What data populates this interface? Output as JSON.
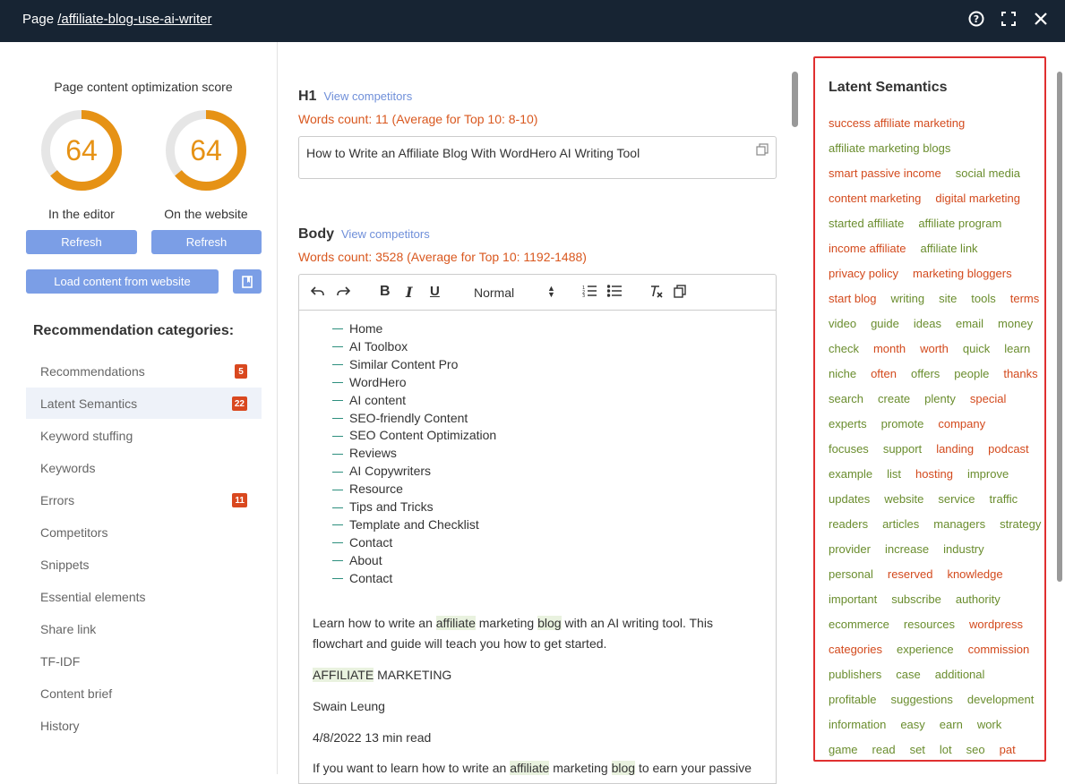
{
  "header": {
    "page_prefix": "Page ",
    "page_path": "/affiliate-blog-use-ai-writer"
  },
  "score": {
    "title": "Page content optimization score",
    "editor_value": "64",
    "editor_label": "In the editor",
    "website_value": "64",
    "website_label": "On the website",
    "refresh_label": "Refresh",
    "load_label": "Load content from website",
    "value_fraction": 0.64
  },
  "recommendations": {
    "title": "Recommendation categories:",
    "items": [
      {
        "label": "Recommendations",
        "badge": "5"
      },
      {
        "label": "Latent Semantics",
        "badge": "22"
      },
      {
        "label": "Keyword stuffing",
        "badge": ""
      },
      {
        "label": "Keywords",
        "badge": ""
      },
      {
        "label": "Errors",
        "badge": "11"
      },
      {
        "label": "Competitors",
        "badge": ""
      },
      {
        "label": "Snippets",
        "badge": ""
      },
      {
        "label": "Essential elements",
        "badge": ""
      },
      {
        "label": "Share link",
        "badge": ""
      },
      {
        "label": "TF-IDF",
        "badge": ""
      },
      {
        "label": "Content brief",
        "badge": ""
      },
      {
        "label": "History",
        "badge": ""
      }
    ]
  },
  "h1": {
    "label": "H1",
    "view_competitors": "View competitors",
    "words_count": "Words count: 11 (Average for Top 10: 8-10)",
    "text": "How to Write an Affiliate Blog With WordHero AI Writing Tool"
  },
  "body": {
    "label": "Body",
    "view_competitors": "View competitors",
    "words_count": "Words count: 3528 (Average for Top 10: 1192-1488)",
    "format_select": "Normal",
    "menu": [
      "Home",
      "AI Toolbox",
      "Similar Content Pro",
      "WordHero",
      "AI content",
      "SEO-friendly Content",
      "SEO Content Optimization",
      "Reviews",
      "AI Copywriters",
      "Resource",
      "Tips and Tricks",
      "Template and Checklist",
      "Contact",
      "About",
      "Contact"
    ],
    "p1_a": "Learn how to write an ",
    "p1_hl1": "affiliate",
    "p1_b": " marketing ",
    "p1_hl2": "blog",
    "p1_c": " with an AI writing tool. This",
    "p1_line2": "flowchart and guide will teach you how to get started.",
    "p2_hl": "AFFILIATE",
    "p2_rest": " MARKETING",
    "author": "Swain Leung",
    "date": "4/8/2022 13 min read",
    "p3_a": "If you want to learn how to write an ",
    "p3_hl1": "affiliate",
    "p3_b": " marketing ",
    "p3_hl2": "blog",
    "p3_c": " to earn your passive"
  },
  "latent": {
    "title": "Latent Semantics",
    "colors": {
      "red": "#d34a1d",
      "green": "#6a8d2e"
    },
    "rows": [
      [
        [
          "success affiliate marketing",
          "r"
        ]
      ],
      [
        [
          "affiliate marketing blogs",
          "g"
        ]
      ],
      [
        [
          "smart passive income",
          "r"
        ],
        [
          "social media",
          "g"
        ]
      ],
      [
        [
          "content marketing",
          "r"
        ],
        [
          "digital marketing",
          "r"
        ]
      ],
      [
        [
          "started affiliate",
          "g"
        ],
        [
          "affiliate program",
          "g"
        ]
      ],
      [
        [
          "income affiliate",
          "r"
        ],
        [
          "affiliate link",
          "g"
        ]
      ],
      [
        [
          "privacy policy",
          "r"
        ],
        [
          "marketing bloggers",
          "r"
        ]
      ],
      [
        [
          "start blog",
          "r"
        ],
        [
          "writing",
          "g"
        ],
        [
          "site",
          "g"
        ],
        [
          "tools",
          "g"
        ],
        [
          "terms",
          "r"
        ]
      ],
      [
        [
          "video",
          "g"
        ],
        [
          "guide",
          "g"
        ],
        [
          "ideas",
          "g"
        ],
        [
          "email",
          "g"
        ],
        [
          "money",
          "g"
        ]
      ],
      [
        [
          "check",
          "g"
        ],
        [
          "month",
          "r"
        ],
        [
          "worth",
          "r"
        ],
        [
          "quick",
          "g"
        ],
        [
          "learn",
          "g"
        ]
      ],
      [
        [
          "niche",
          "g"
        ],
        [
          "often",
          "r"
        ],
        [
          "offers",
          "g"
        ],
        [
          "people",
          "g"
        ],
        [
          "thanks",
          "r"
        ]
      ],
      [
        [
          "search",
          "g"
        ],
        [
          "create",
          "g"
        ],
        [
          "plenty",
          "g"
        ],
        [
          "special",
          "r"
        ]
      ],
      [
        [
          "experts",
          "g"
        ],
        [
          "promote",
          "g"
        ],
        [
          "company",
          "r"
        ]
      ],
      [
        [
          "focuses",
          "g"
        ],
        [
          "support",
          "g"
        ],
        [
          "landing",
          "r"
        ],
        [
          "podcast",
          "r"
        ]
      ],
      [
        [
          "example",
          "g"
        ],
        [
          "list",
          "g"
        ],
        [
          "hosting",
          "r"
        ],
        [
          "improve",
          "g"
        ]
      ],
      [
        [
          "updates",
          "g"
        ],
        [
          "website",
          "g"
        ],
        [
          "service",
          "g"
        ],
        [
          "traffic",
          "g"
        ]
      ],
      [
        [
          "readers",
          "g"
        ],
        [
          "articles",
          "g"
        ],
        [
          "managers",
          "g"
        ],
        [
          "strategy",
          "g"
        ]
      ],
      [
        [
          "provider",
          "g"
        ],
        [
          "increase",
          "g"
        ],
        [
          "industry",
          "g"
        ]
      ],
      [
        [
          "personal",
          "g"
        ],
        [
          "reserved",
          "r"
        ],
        [
          "knowledge",
          "r"
        ]
      ],
      [
        [
          "important",
          "g"
        ],
        [
          "subscribe",
          "g"
        ],
        [
          "authority",
          "g"
        ]
      ],
      [
        [
          "ecommerce",
          "g"
        ],
        [
          "resources",
          "g"
        ],
        [
          "wordpress",
          "r"
        ]
      ],
      [
        [
          "categories",
          "r"
        ],
        [
          "experience",
          "g"
        ],
        [
          "commission",
          "r"
        ]
      ],
      [
        [
          "publishers",
          "g"
        ],
        [
          "case",
          "g"
        ],
        [
          "additional",
          "g"
        ]
      ],
      [
        [
          "profitable",
          "g"
        ],
        [
          "suggestions",
          "g"
        ],
        [
          "development",
          "g"
        ]
      ],
      [
        [
          "information",
          "g"
        ],
        [
          "easy",
          "g"
        ],
        [
          "earn",
          "g"
        ],
        [
          "work",
          "g"
        ]
      ],
      [
        [
          "game",
          "g"
        ],
        [
          "read",
          "g"
        ],
        [
          "set",
          "g"
        ],
        [
          "lot",
          "g"
        ],
        [
          "seo",
          "g"
        ],
        [
          "pat",
          "r"
        ]
      ]
    ]
  }
}
